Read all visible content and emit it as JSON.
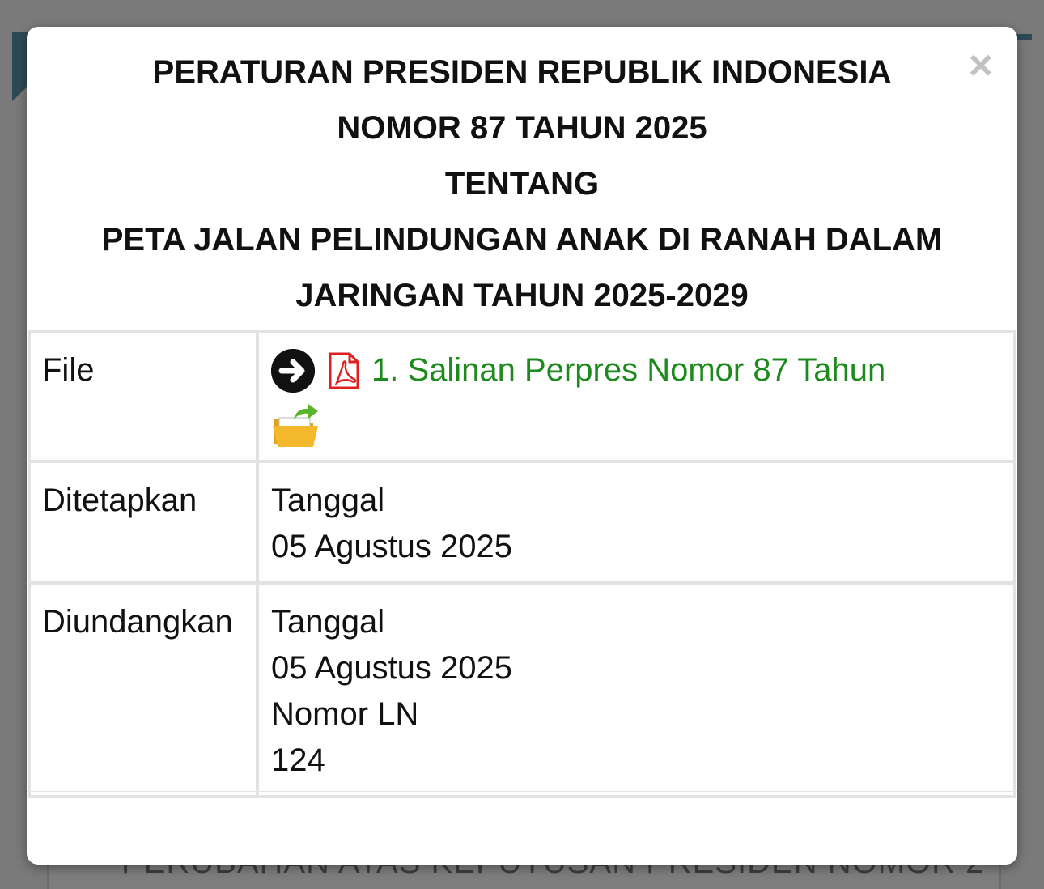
{
  "background": {
    "partial_text": "PERUBAHAN ATAS KEPUTUSAN PRESIDEN NOMOR 2"
  },
  "modal": {
    "title_lines": [
      "PERATURAN PRESIDEN REPUBLIK INDONESIA",
      "NOMOR 87 TAHUN 2025",
      "TENTANG",
      "PETA JALAN PELINDUNGAN ANAK DI RANAH DALAM",
      "JARINGAN TAHUN 2025-2029"
    ],
    "close_label": "×",
    "rows": {
      "file": {
        "label": "File",
        "link_text": "1. Salinan Perpres Nomor 87 Tahun",
        "icons": [
          "arrow-right-circle-icon",
          "pdf-icon",
          "folder-open-icon"
        ]
      },
      "ditetapkan": {
        "label": "Ditetapkan",
        "lines": [
          "Tanggal",
          "05 Agustus 2025"
        ]
      },
      "diundangkan": {
        "label": "Diundangkan",
        "lines": [
          "Tanggal",
          "05 Agustus 2025",
          "Nomor LN",
          "124"
        ]
      }
    }
  },
  "colors": {
    "link": "#1e8a1e",
    "pdf_icon": "#e02020",
    "overlay": "#7a7a7a",
    "border": "#e2e2e2"
  }
}
